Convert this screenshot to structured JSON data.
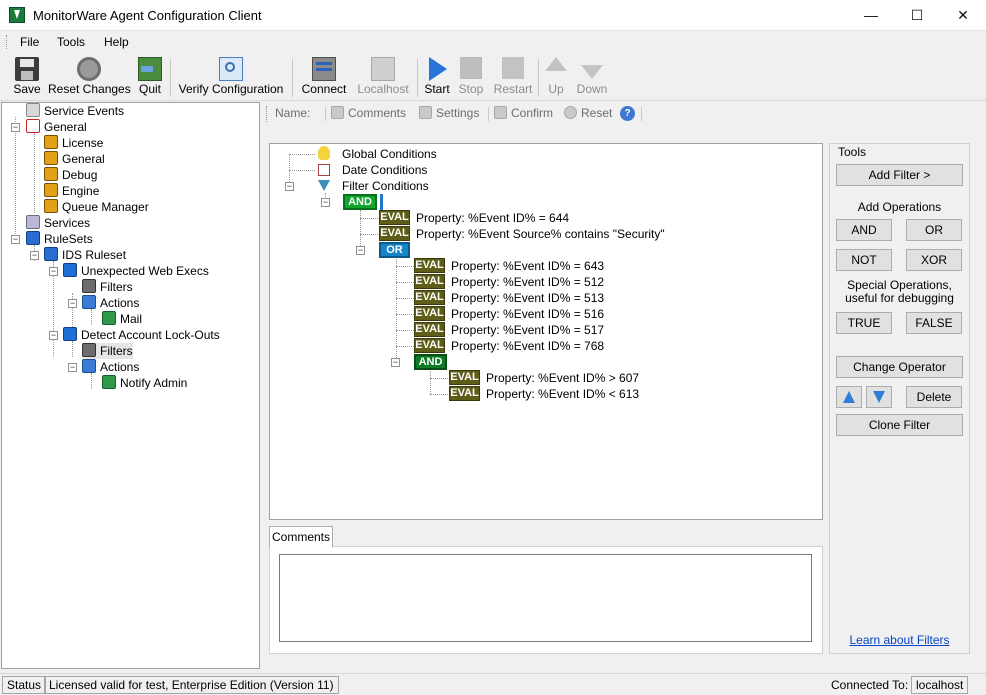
{
  "window": {
    "title": "MonitorWare Agent Configuration Client",
    "min_glyph": "—",
    "max_glyph": "☐",
    "close_glyph": "✕"
  },
  "menu": [
    "File",
    "Tools",
    "Help"
  ],
  "toolbar": {
    "save": "Save",
    "reset_changes": "Reset Changes",
    "quit": "Quit",
    "verify": "Verify Configuration",
    "connect": "Connect",
    "localhost": "Localhost",
    "start": "Start",
    "stop": "Stop",
    "restart": "Restart",
    "up": "Up",
    "down": "Down"
  },
  "tree": {
    "service_events": "Service Events",
    "general": "General",
    "license": "License",
    "general_child": "General",
    "debug": "Debug",
    "engine": "Engine",
    "queue_manager": "Queue Manager",
    "services": "Services",
    "rulesets": "RuleSets",
    "ids_ruleset": "IDS Ruleset",
    "unexpected_web": "Unexpected Web Execs",
    "filters_1": "Filters",
    "actions_1": "Actions",
    "mail": "Mail",
    "detect_lockouts": "Detect Account Lock-Outs",
    "filters_2": "Filters",
    "actions_2": "Actions",
    "notify_admin": "Notify Admin"
  },
  "propbar": {
    "name_label": "Name:",
    "comments": "Comments",
    "settings": "Settings",
    "confirm": "Confirm",
    "reset": "Reset",
    "help_glyph": "?"
  },
  "filter_tree": {
    "global_conditions": "Global Conditions",
    "date_conditions": "Date Conditions",
    "filter_conditions": "Filter Conditions",
    "op_and": "AND",
    "op_or": "OR",
    "op_and_inner": "AND",
    "eval_label": "EVAL",
    "rows": [
      "Property: %Event ID% = 644",
      "Property: %Event Source% contains \"Security\"",
      "Property: %Event ID% = 643",
      "Property: %Event ID% = 512",
      "Property: %Event ID% = 513",
      "Property: %Event ID% = 516",
      "Property: %Event ID% = 517",
      "Property: %Event ID% = 768",
      "Property: %Event ID% >  607",
      "Property: %Event ID% < 613"
    ]
  },
  "tools": {
    "heading": "Tools",
    "add_filter": "Add Filter >",
    "add_operations": "Add Operations",
    "and": "AND",
    "or": "OR",
    "not": "NOT",
    "xor": "XOR",
    "special_ops": "Special Operations, useful for debugging",
    "true": "TRUE",
    "false": "FALSE",
    "change_operator": "Change Operator",
    "delete": "Delete",
    "clone_filter": "Clone Filter",
    "learn_link": "Learn about Filters",
    "colors": {
      "up_arrow": "#2d7fd6",
      "down_arrow": "#2d7fd6"
    }
  },
  "comments": {
    "tab_label": "Comments",
    "value": ""
  },
  "status": {
    "label": "Status",
    "license": "Licensed valid for test, Enterprise Edition (Version 11)",
    "connected_label": "Connected To:",
    "connected_value": "localhost"
  },
  "colors": {
    "and_green": "#11a52e",
    "or_blue": "#1585c8",
    "eval_olive": "#5d5d17"
  }
}
